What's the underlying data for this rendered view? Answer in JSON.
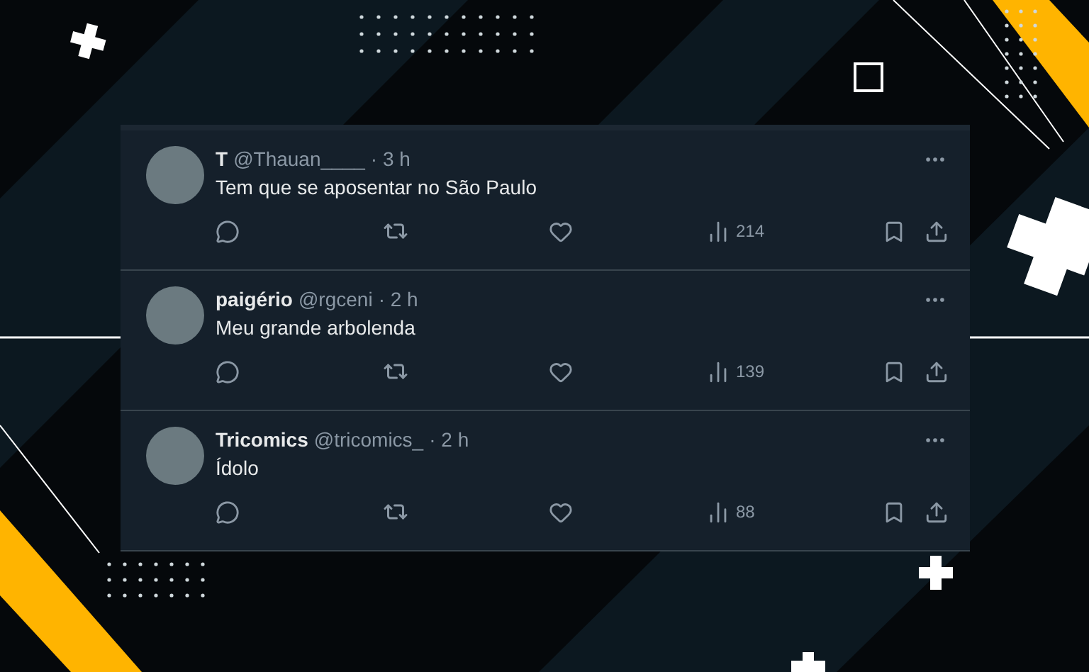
{
  "tweets": [
    {
      "name": "T",
      "handle": "@Thauan____",
      "time": "· 3 h",
      "text": "Tem que se aposentar no São Paulo",
      "views": "214"
    },
    {
      "name": "paigério",
      "handle": "@rgceni",
      "time": "· 2 h",
      "text": "Meu grande arbolenda",
      "views": "139"
    },
    {
      "name": "Tricomics",
      "handle": "@tricomics_",
      "time": "· 2 h",
      "text": "Ídolo",
      "views": "88"
    }
  ]
}
